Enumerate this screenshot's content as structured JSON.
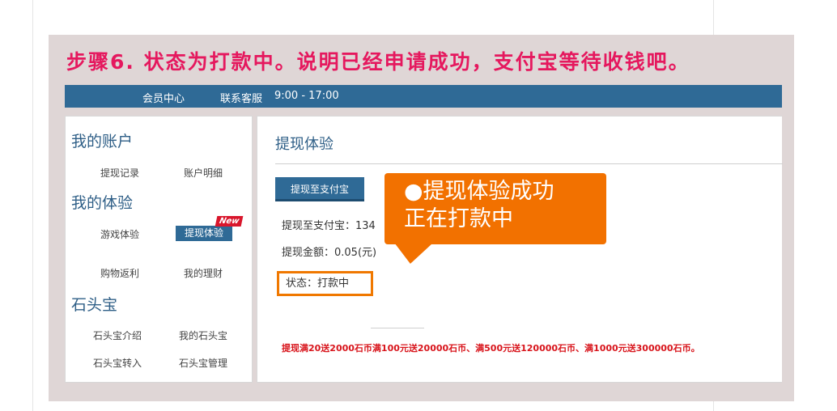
{
  "headline": "步骤6. 状态为打款中。说明已经申请成功，支付宝等待收钱吧。",
  "topbar": {
    "member_center": "会员中心",
    "customer_service": "联系客服",
    "hours": "9:00 - 17:00"
  },
  "sidebar": {
    "sections": [
      {
        "title": "我的账户",
        "links": [
          "提现记录",
          "账户明细"
        ]
      },
      {
        "title": "我的体验",
        "links": [
          "游戏体验",
          "提现体验",
          "购物返利",
          "我的理财"
        ]
      },
      {
        "title": "石头宝",
        "links": [
          "石头宝介绍",
          "我的石头宝",
          "石头宝转入",
          "石头宝管理"
        ]
      }
    ],
    "new_badge": "New"
  },
  "main": {
    "title": "提现体验",
    "withdraw_button": "提现至支付宝",
    "withdraw_to_alipay": "提现至支付宝：134",
    "withdraw_amount": "提现金额：0.05(元)",
    "status": "状态：打款中",
    "promo": "提现满20送2000石币满100元送20000石币、满500元送120000石币、满1000元送300000石币。"
  },
  "callout": {
    "line1": "●提现体验成功",
    "line2": "正在打款中"
  },
  "colors": {
    "headline": "#e5185e",
    "nav_bar": "#2f6a96",
    "callout": "#f27100",
    "promo": "#d8141b"
  }
}
